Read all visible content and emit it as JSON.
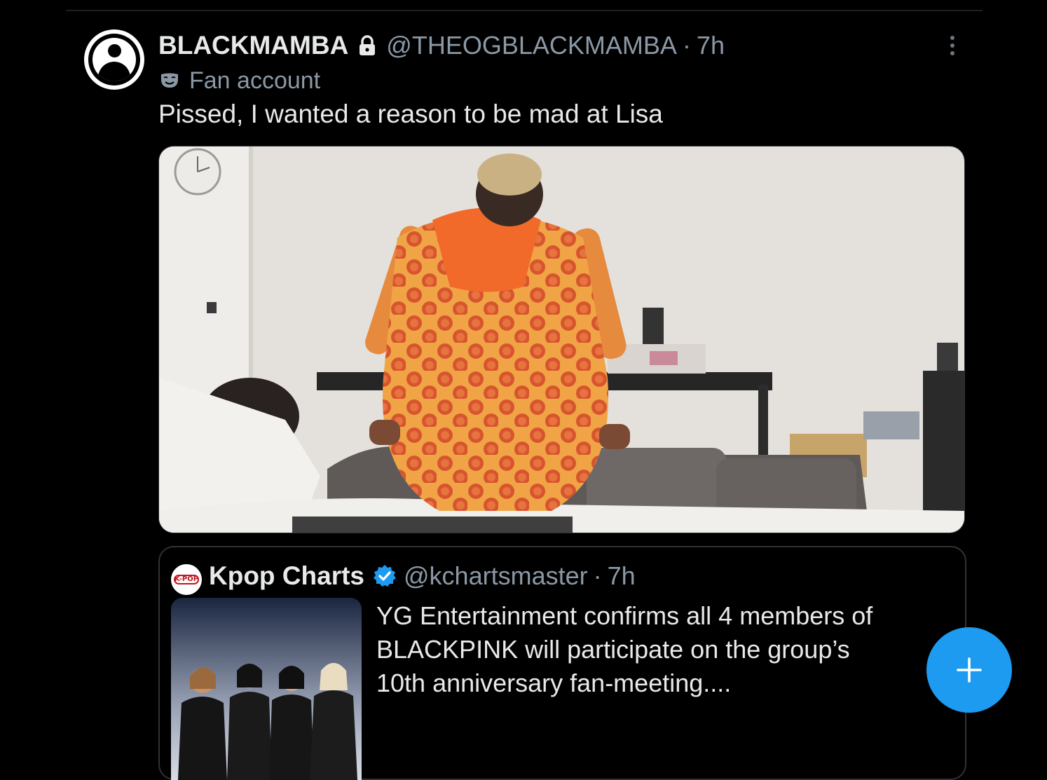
{
  "post": {
    "display_name": "BLACKMAMBA",
    "handle": "@THEOGBLACKMAMBA",
    "separator": "·",
    "time": "7h",
    "account_label": "Fan account",
    "text": "Pissed, I wanted a reason to be mad at Lisa",
    "icons": {
      "avatar": "default-avatar-icon",
      "lock": "lock-icon",
      "label": "mask-icon",
      "more": "more-vertical-icon"
    }
  },
  "quote": {
    "avatar_text": "K-POP",
    "display_name": "Kpop Charts",
    "handle": "@kchartsmaster",
    "separator": "·",
    "time": "7h",
    "text_lines": [
      "YG Entertainment confirms all 4 members of",
      "BLACKPINK will participate on the group’s",
      "10th anniversary fan-meeting...."
    ],
    "icons": {
      "verified": "verified-badge-icon"
    }
  },
  "fab": {
    "icon": "plus-icon",
    "label": "+"
  },
  "colors": {
    "background": "#000000",
    "text_primary": "#e7e9ea",
    "text_secondary": "#8b98a5",
    "border": "#2f3336",
    "accent": "#1d9bf0"
  }
}
